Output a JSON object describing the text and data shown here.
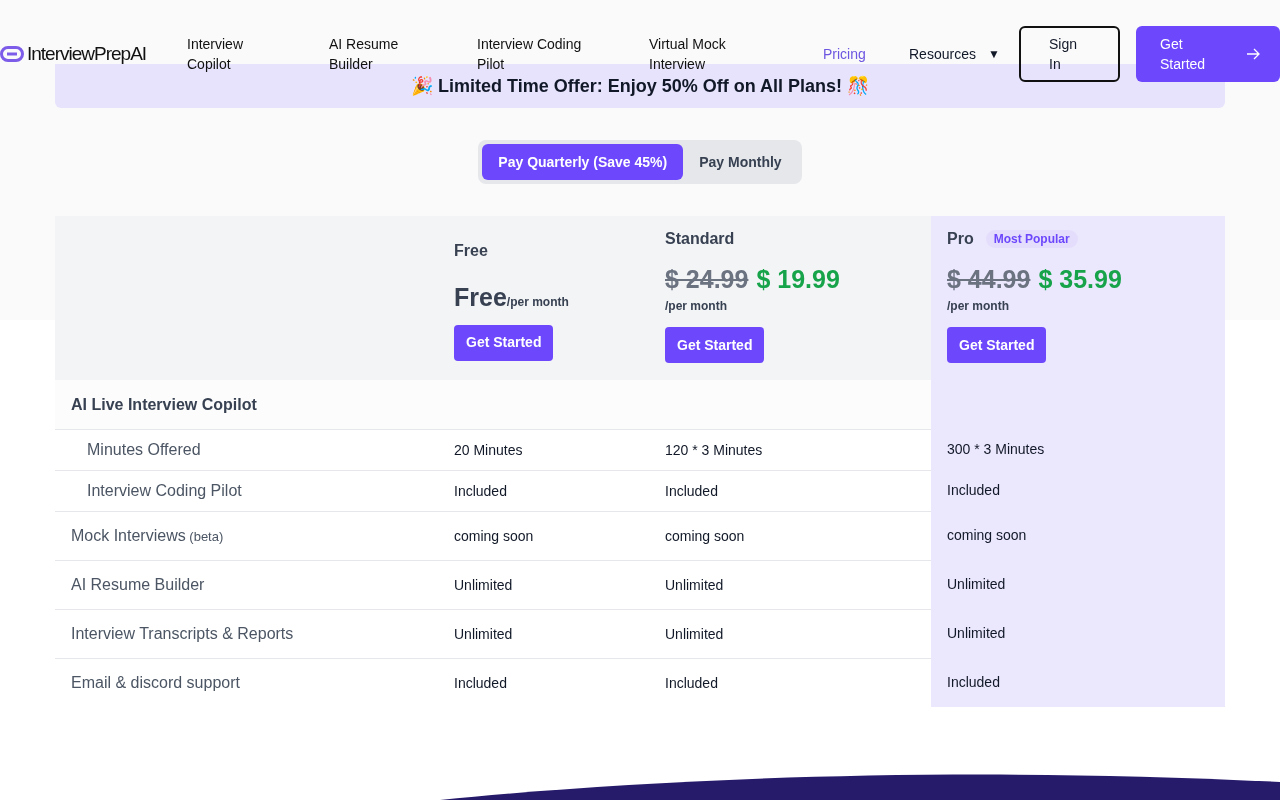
{
  "header": {
    "logo": "InterviewPrepAI",
    "nav": [
      {
        "label": "Interview Copilot",
        "selected": false
      },
      {
        "label": "AI Resume Builder",
        "selected": false
      },
      {
        "label": "Interview Coding Pilot",
        "selected": false
      },
      {
        "label": "Virtual Mock Interview",
        "selected": false
      },
      {
        "label": "Pricing",
        "selected": true
      }
    ],
    "resources": {
      "label": "Resources",
      "caret": "▼"
    },
    "sign_in": "Sign In",
    "get_started": "Get Started"
  },
  "banner": {
    "text": "🎉 Limited Time Offer: Enjoy 50% Off on All Plans! 🎊"
  },
  "billing_toggle": [
    {
      "label": "Pay Quarterly (Save 45%)",
      "selected": true
    },
    {
      "label": "Pay Monthly",
      "selected": false
    }
  ],
  "plans": [
    {
      "name": "Free",
      "highlighted": false,
      "price": "Free",
      "period": "/per month",
      "button": "Get Started"
    },
    {
      "name": "Standard",
      "highlighted": false,
      "old_price": "$ 24.99",
      "price": "$ 19.99",
      "period": "/per month",
      "button": "Get Started"
    },
    {
      "name": "Pro",
      "highlighted": true,
      "badge": "Most Popular",
      "old_price": "$ 44.99",
      "price": "$ 35.99",
      "period": "/per month",
      "button": "Get Started"
    }
  ],
  "rows": [
    {
      "kind": "section",
      "label": "AI Live Interview Copilot",
      "cells": []
    },
    {
      "kind": "sub",
      "label": "Minutes Offered",
      "cells": [
        "20 Minutes",
        "120 * 3 Minutes",
        "300 * 3 Minutes"
      ]
    },
    {
      "kind": "sub",
      "label": "Interview Coding Pilot",
      "cells": [
        "Included",
        "Included",
        "Included"
      ]
    },
    {
      "kind": "feature",
      "label": "Mock Interviews",
      "note": "(beta)",
      "cells": [
        "coming soon",
        "coming soon",
        "coming soon"
      ]
    },
    {
      "kind": "feature",
      "label": "AI Resume Builder",
      "cells": [
        "Unlimited",
        "Unlimited",
        "Unlimited"
      ]
    },
    {
      "kind": "feature",
      "label": "Interview Transcripts & Reports",
      "cells": [
        "Unlimited",
        "Unlimited",
        "Unlimited"
      ]
    },
    {
      "kind": "feature",
      "label": "Email & discord support",
      "cells": [
        "Included",
        "Included",
        "Included"
      ]
    }
  ]
}
